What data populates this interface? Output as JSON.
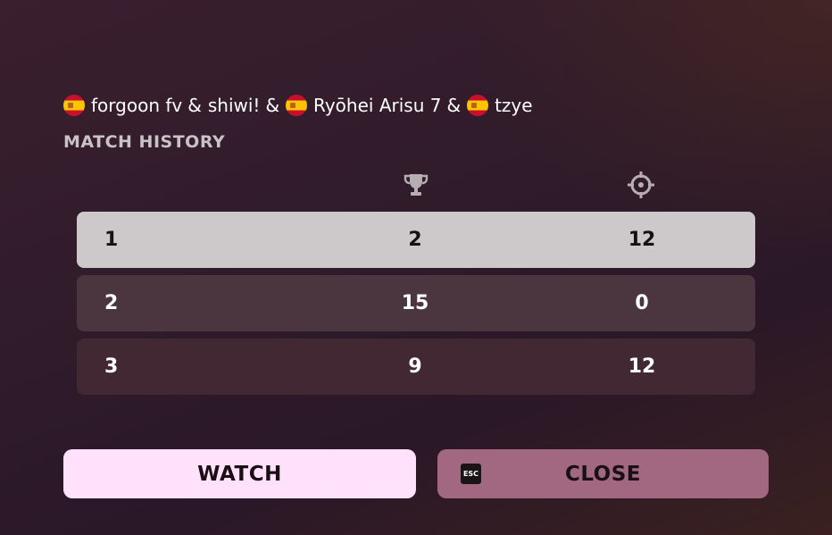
{
  "players": [
    {
      "name": "forgoon fv",
      "flag": "spain-flag-icon"
    },
    {
      "name": "shiwi!",
      "flag": null
    },
    {
      "name": "Ryōhei Arisu 7",
      "flag": "spain-flag-icon"
    },
    {
      "name": "tzye",
      "flag": "spain-flag-icon"
    }
  ],
  "separator": "&",
  "history": {
    "title": "MATCH HISTORY",
    "columns": [
      {
        "icon": "trophy-icon"
      },
      {
        "icon": "crosshair-icon"
      }
    ],
    "rows": [
      {
        "rank": "1",
        "score": "2",
        "eliminations": "12",
        "selected": true
      },
      {
        "rank": "2",
        "score": "15",
        "eliminations": "0",
        "selected": false
      },
      {
        "rank": "3",
        "score": "9",
        "eliminations": "12",
        "selected": false
      }
    ]
  },
  "buttons": {
    "watch": "WATCH",
    "close": "CLOSE",
    "close_key": "ESC"
  },
  "colors": {
    "selected_row": "#cdc8c9",
    "row": "#4b353e",
    "watch_button": "#ffe1fb",
    "close_button": "#a26781"
  }
}
